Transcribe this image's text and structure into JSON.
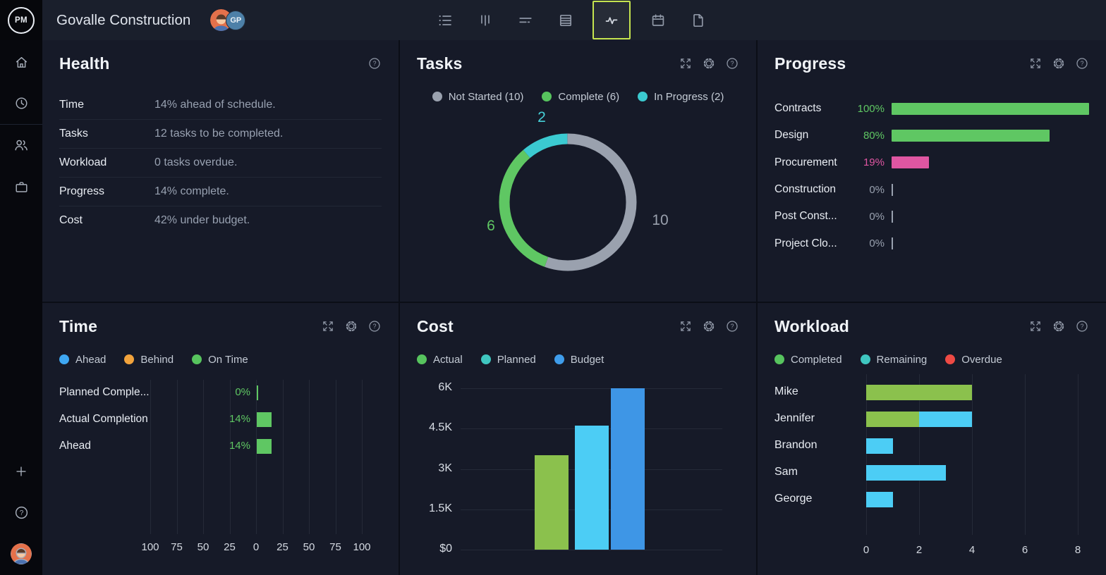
{
  "app": {
    "logo_text": "PM",
    "title": "Govalle Construction",
    "member_badge": "GP"
  },
  "toolbar": {
    "items": [
      "list-view",
      "board-view",
      "gantt-view",
      "sheet-view",
      "dashboard-view",
      "calendar-view",
      "files-view"
    ],
    "selected": "dashboard-view",
    "selected_border_color": "#c6e44f"
  },
  "panels": {
    "health": {
      "title": "Health",
      "rows": [
        {
          "label": "Time",
          "value": "14% ahead of schedule."
        },
        {
          "label": "Tasks",
          "value": "12 tasks to be completed."
        },
        {
          "label": "Workload",
          "value": "0 tasks overdue."
        },
        {
          "label": "Progress",
          "value": "14% complete."
        },
        {
          "label": "Cost",
          "value": "42% under budget."
        }
      ]
    },
    "tasks": {
      "title": "Tasks",
      "legend": [
        {
          "label": "Not Started (10)",
          "color": "#9aa1ae"
        },
        {
          "label": "Complete (6)",
          "color": "#57c45e"
        },
        {
          "label": "In Progress (2)",
          "color": "#3bc9cf"
        }
      ]
    },
    "progress": {
      "title": "Progress"
    },
    "time": {
      "title": "Time",
      "legend": [
        {
          "label": "Ahead",
          "color": "#3ea7f2"
        },
        {
          "label": "Behind",
          "color": "#f2a33c"
        },
        {
          "label": "On Time",
          "color": "#57c45e"
        }
      ]
    },
    "cost": {
      "title": "Cost",
      "legend": [
        {
          "label": "Actual",
          "color": "#57c45e"
        },
        {
          "label": "Planned",
          "color": "#3fc6c0"
        },
        {
          "label": "Budget",
          "color": "#3f9deb"
        }
      ]
    },
    "workload": {
      "title": "Workload",
      "legend": [
        {
          "label": "Completed",
          "color": "#57c45e"
        },
        {
          "label": "Remaining",
          "color": "#3fc6c0"
        },
        {
          "label": "Overdue",
          "color": "#ee4a44"
        }
      ]
    }
  },
  "chart_data": [
    {
      "id": "tasks-donut",
      "type": "pie",
      "title": "Tasks",
      "labels": [
        "Not Started",
        "Complete",
        "In Progress"
      ],
      "values": [
        10,
        6,
        2
      ],
      "colors": [
        "#9aa1ae",
        "#5fc763",
        "#3bcad1"
      ],
      "label_colors": [
        "#9aa1ae",
        "#5fc763",
        "#46d0d8"
      ]
    },
    {
      "id": "progress-bars",
      "type": "bar",
      "orientation": "horizontal",
      "categories": [
        "Contracts",
        "Design",
        "Procurement",
        "Construction",
        "Post Const...",
        "Project Clo..."
      ],
      "values": [
        100,
        80,
        19,
        0,
        0,
        0
      ],
      "value_labels": [
        "100%",
        "80%",
        "19%",
        "0%",
        "0%",
        "0%"
      ],
      "colors": [
        "#5fc763",
        "#5fc763",
        "#df56a2",
        "#99a1af",
        "#99a1af",
        "#99a1af"
      ],
      "xlim": [
        0,
        100
      ]
    },
    {
      "id": "time-bars",
      "type": "bar",
      "orientation": "horizontal",
      "categories": [
        "Planned Comple...",
        "Actual Completion",
        "Ahead"
      ],
      "values": [
        0,
        14,
        14
      ],
      "value_labels": [
        "0%",
        "14%",
        "14%"
      ],
      "bar_color": "#5fc763",
      "x_ticks": [
        "100",
        "75",
        "50",
        "25",
        "0",
        "25",
        "50",
        "75",
        "100"
      ],
      "xlim": [
        -100,
        100
      ]
    },
    {
      "id": "cost-bars",
      "type": "bar",
      "categories": [
        "Actual",
        "Planned",
        "Budget"
      ],
      "values": [
        3500,
        4600,
        6000
      ],
      "colors": [
        "#8bc14d",
        "#4ccdf5",
        "#3e96e6"
      ],
      "y_ticks": [
        "6K",
        "4.5K",
        "3K",
        "1.5K",
        "$0"
      ],
      "y_tick_values": [
        6000,
        4500,
        3000,
        1500,
        0
      ],
      "ylim": [
        0,
        6000
      ]
    },
    {
      "id": "workload-bars",
      "type": "stacked_bar",
      "orientation": "horizontal",
      "categories": [
        "Mike",
        "Jennifer",
        "Brandon",
        "Sam",
        "George"
      ],
      "series": [
        {
          "name": "Completed",
          "color": "#8bc14d",
          "values": [
            4,
            2,
            0,
            0,
            0
          ]
        },
        {
          "name": "Remaining",
          "color": "#4ccdf5",
          "values": [
            0,
            2,
            1,
            3,
            1
          ]
        },
        {
          "name": "Overdue",
          "color": "#ee4a44",
          "values": [
            0,
            0,
            0,
            0,
            0
          ]
        }
      ],
      "x_ticks": [
        "0",
        "2",
        "4",
        "6",
        "8"
      ],
      "xlim": [
        0,
        8
      ]
    }
  ]
}
